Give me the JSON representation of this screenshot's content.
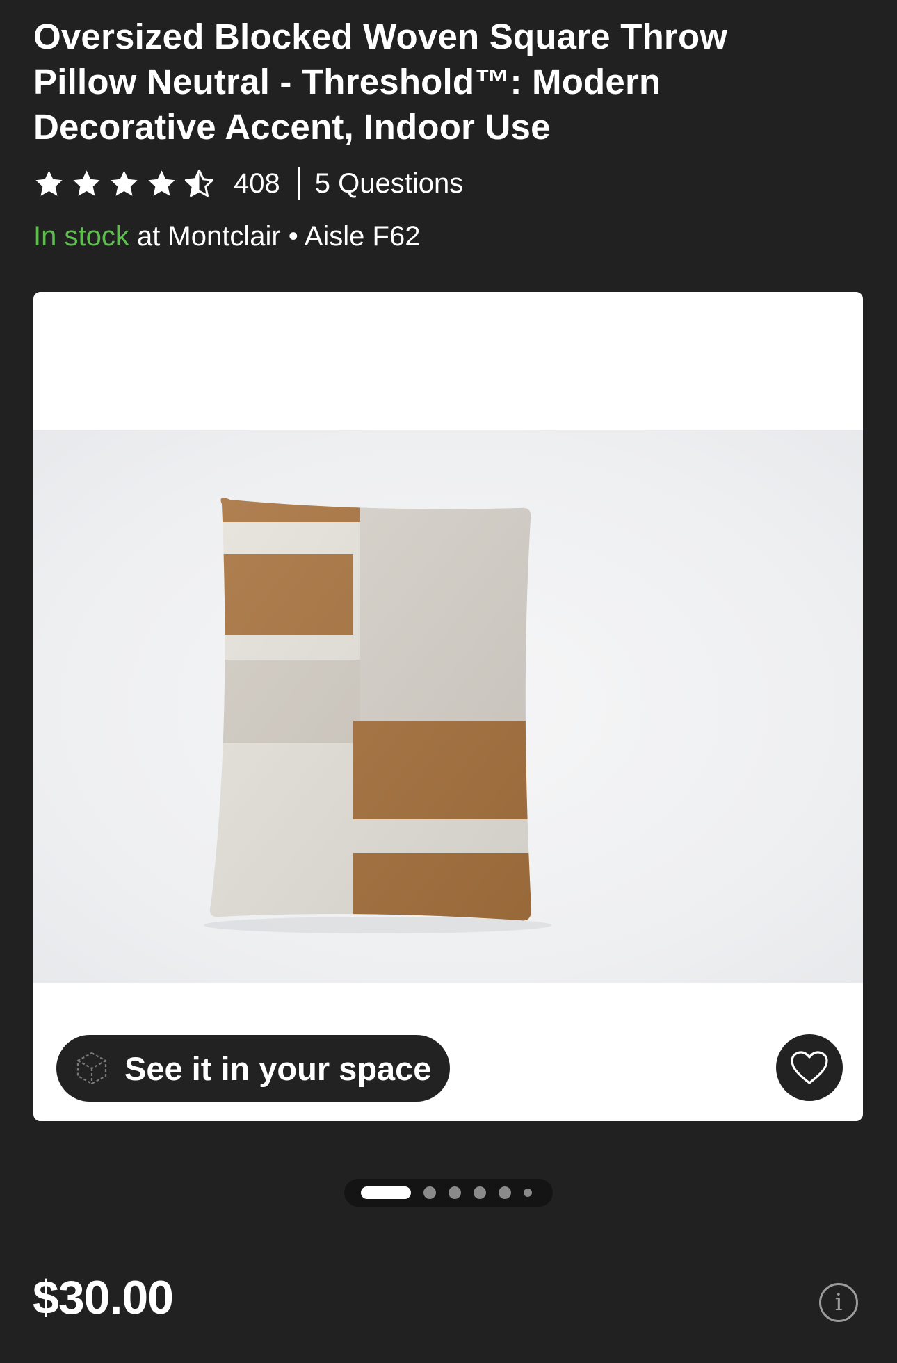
{
  "product": {
    "title": "Oversized Blocked Woven Square Throw Pillow Neutral - Threshold™: Modern Decorative Accent, Indoor Use",
    "rating": 4.5,
    "rating_max": 5,
    "review_count": "408",
    "questions": "5 Questions"
  },
  "availability": {
    "status": "In stock",
    "location": " at Montclair • Aisle F62",
    "status_color": "#5fbd4f"
  },
  "gallery": {
    "see_in_space_label": "See it in your space",
    "image_count": 6,
    "active_index": 0,
    "icons": {
      "ar": "ar-cube-icon",
      "favorite": "heart-icon"
    }
  },
  "pricing": {
    "price": "$30.00",
    "info_icon": "info-icon"
  },
  "colors": {
    "background": "#212121",
    "text": "#ffffff",
    "button_bg": "#222222"
  }
}
